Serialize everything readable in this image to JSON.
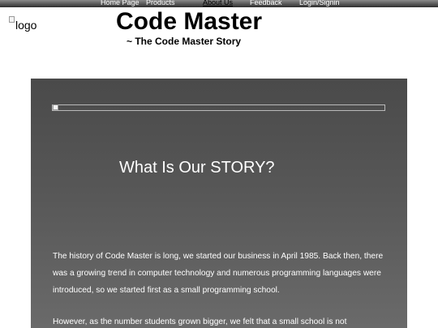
{
  "nav": {
    "items": [
      {
        "label": "Home Page",
        "active": false
      },
      {
        "label": "Products",
        "active": false
      },
      {
        "label": "About Us",
        "active": true
      },
      {
        "label": "Feedback",
        "active": false
      },
      {
        "label": "Login/Signin",
        "active": false
      }
    ]
  },
  "header": {
    "logo_alt": "logo",
    "title": "Code Master",
    "subtitle": "~ The Code Master Story"
  },
  "story": {
    "heading": "What Is Our STORY?",
    "paragraphs": [
      "The history of Code Master is long, we started our business in April 1985. Back then, there was a growing trend in computer technology and numerous programming languages were introduced, so we started first as a small programming school.",
      "However, as the number students grown bigger, we felt that a small school is not"
    ]
  },
  "colors": {
    "nav_gradient_top": "#8a8a8a",
    "nav_gradient_bottom": "#2e2e2e",
    "panel_top": "#4a4a4a",
    "panel_bottom": "#6a6a6a",
    "text_light": "#ffffff"
  }
}
